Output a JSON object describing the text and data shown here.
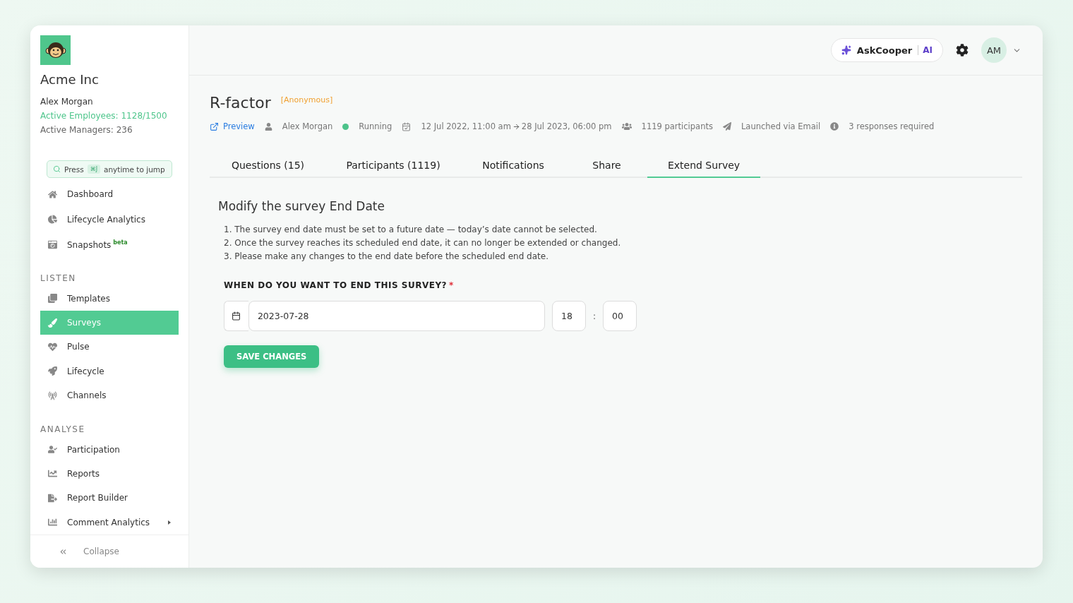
{
  "org": {
    "name": "Acme Inc",
    "user": "Alex Morgan",
    "employees": "Active Employees: 1128/1500",
    "managers": "Active Managers: 236"
  },
  "jump": {
    "before": "Press",
    "key": "⌘J",
    "after": "anytime to jump"
  },
  "nav": [
    {
      "items": [
        {
          "label": "Dashboard",
          "selected": false
        },
        {
          "label": "Lifecycle Analytics",
          "selected": false
        },
        {
          "label": "Snapshots",
          "badge": "beta",
          "selected": false
        }
      ]
    },
    {
      "heading": "LISTEN",
      "items": [
        {
          "label": "Templates",
          "selected": false
        },
        {
          "label": "Surveys",
          "selected": true
        },
        {
          "label": "Pulse",
          "selected": false
        },
        {
          "label": "Lifecycle",
          "selected": false
        },
        {
          "label": "Channels",
          "selected": false
        }
      ]
    },
    {
      "heading": "ANALYSE",
      "items": [
        {
          "label": "Participation",
          "selected": false
        },
        {
          "label": "Reports",
          "selected": false
        },
        {
          "label": "Report Builder",
          "selected": false
        },
        {
          "label": "Comment Analytics",
          "selected": false,
          "expandable": true
        }
      ]
    }
  ],
  "collapse": "Collapse",
  "topbar": {
    "assistant": "AskCooper",
    "assistant_tag": "AI",
    "avatar": "AM"
  },
  "survey": {
    "title": "R-factor",
    "tag": "[Anonymous]"
  },
  "meta": [
    {
      "kind": "link",
      "text": "Preview"
    },
    {
      "kind": "person",
      "text": "Alex Morgan"
    },
    {
      "kind": "status",
      "text": "Running",
      "color": "#4cc38a"
    },
    {
      "kind": "dates",
      "text": "12 Jul 2022, 11:00 am",
      "text_end": "28 Jul 2023, 06:00 pm"
    },
    {
      "kind": "people",
      "text": "1119 participants"
    },
    {
      "kind": "send",
      "text": "Launched via Email"
    },
    {
      "kind": "info",
      "text": "3 responses required"
    }
  ],
  "tabs": [
    {
      "label": "Questions (15)",
      "selected": false
    },
    {
      "label": "Participants (1119)",
      "selected": false
    },
    {
      "label": "Notifications",
      "selected": false
    },
    {
      "label": "Share",
      "selected": false
    },
    {
      "label": "Extend Survey",
      "selected": true
    }
  ],
  "form": {
    "heading": "Modify the survey End Date",
    "rules": [
      "1. The survey end date must be set to a future date — today’s date cannot be selected.",
      "2. Once the survey reaches its scheduled end date, it can no longer be extended or changed.",
      "3. Please make any changes to the end date before the scheduled end date."
    ],
    "question": "WHEN DO YOU WANT TO END THIS SURVEY?",
    "required_mark": "*",
    "date": "2023-07-28",
    "hour": "18",
    "separator": ":",
    "minute": "00",
    "save": "SAVE CHANGES"
  }
}
